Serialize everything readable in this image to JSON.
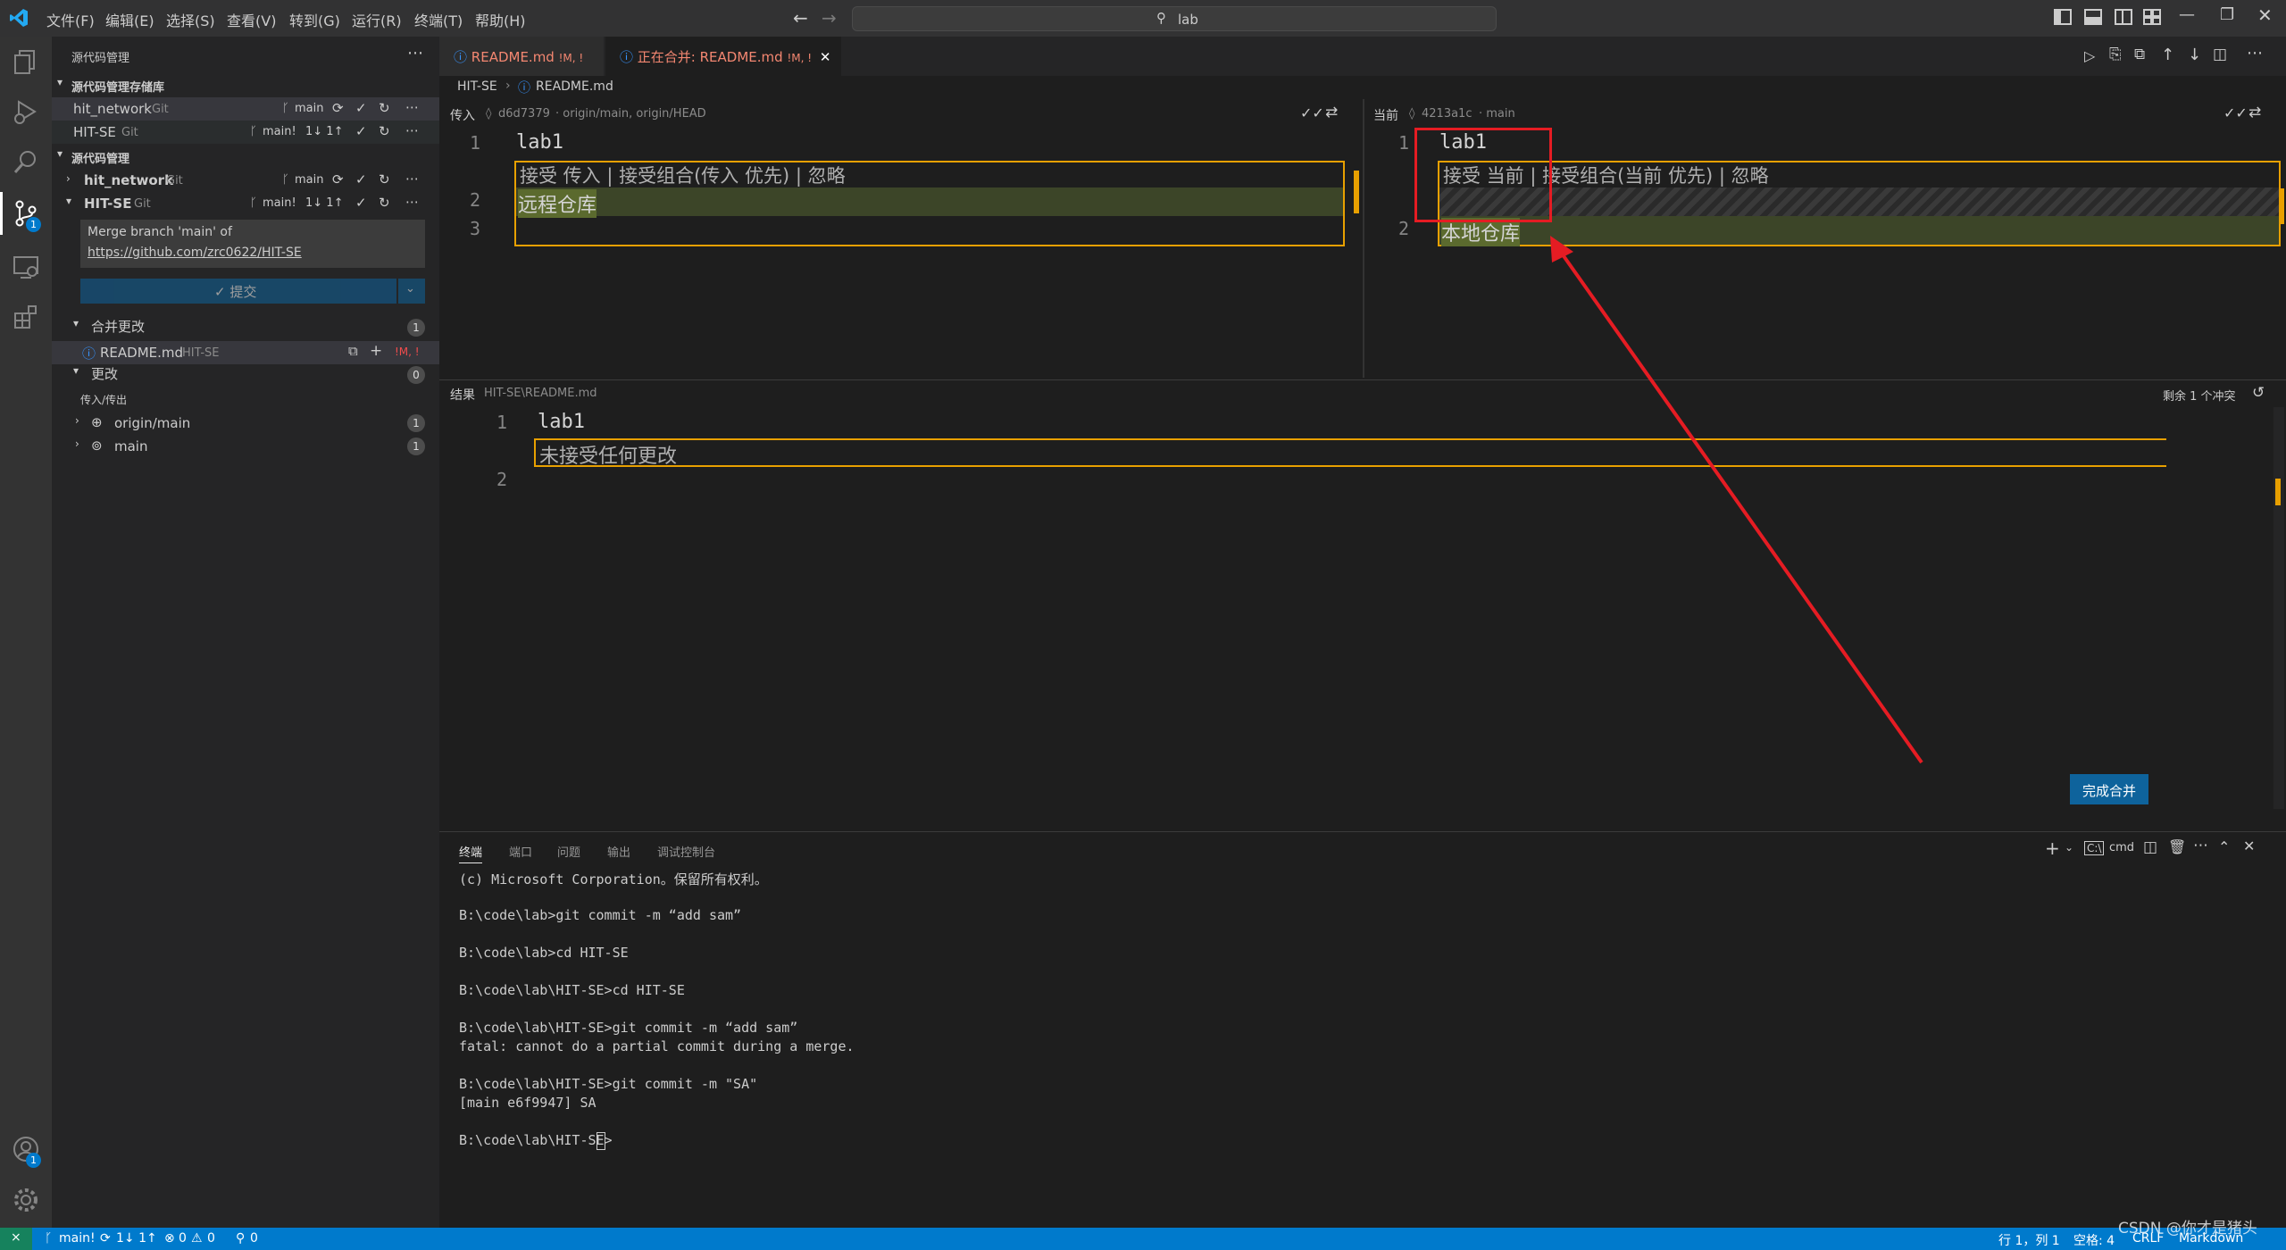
{
  "menu": [
    "文件(F)",
    "编辑(E)",
    "选择(S)",
    "查看(V)",
    "转到(G)",
    "运行(R)",
    "终端(T)",
    "帮助(H)"
  ],
  "search": {
    "text": "lab"
  },
  "sidebar": {
    "title": "源代码管理",
    "repos_section": "源代码管理存储库",
    "repos": [
      {
        "name": "hit_network",
        "type": "Git",
        "branch": "main"
      },
      {
        "name": "HIT-SE",
        "type": "Git",
        "branch": "main!",
        "sync": "1↓ 1↑"
      }
    ],
    "scm_section": "源代码管理",
    "scm_repos": [
      {
        "name": "hit_network",
        "type": "Git",
        "branch": "main"
      },
      {
        "name": "HIT-SE",
        "type": "Git",
        "branch": "main!",
        "sync": "1↓ 1↑"
      }
    ],
    "commit_message_line1": "Merge branch 'main' of",
    "commit_message_line2": "https://github.com/zrc0622/HIT-SE",
    "commit_button": "✓ 提交",
    "merge_changes": {
      "label": "合并更改",
      "count": "1"
    },
    "merge_file": {
      "name": "README.md",
      "repo": "HIT-SE",
      "status": "!M, !"
    },
    "changes": {
      "label": "更改",
      "count": "0"
    },
    "inout_label": "传入/传出",
    "origin_main": {
      "label": "origin/main",
      "count": "1"
    },
    "main": {
      "label": "main",
      "count": "1"
    }
  },
  "tabs": [
    {
      "label": "README.md",
      "status": "!M, !"
    },
    {
      "label": "正在合并: README.md",
      "status": "!M, !"
    }
  ],
  "breadcrumb": {
    "folder": "HIT-SE",
    "file": "README.md"
  },
  "incoming": {
    "label": "传入",
    "hash": "d6d7379",
    "refs": "· origin/main, origin/HEAD",
    "line1": "lab1",
    "actions": "接受 传入 | 接受组合(传入 优先) | 忽略",
    "line2": "远程仓库",
    "nums": [
      "1",
      "2",
      "3"
    ]
  },
  "current": {
    "label": "当前",
    "hash": "4213a1c",
    "refs": "· main",
    "line1": "lab1",
    "actions": "接受 当前 | 接受组合(当前 优先) | 忽略",
    "line2": "本地仓库",
    "nums": [
      "1",
      "2"
    ]
  },
  "result": {
    "label": "结果",
    "path": "HIT-SE\\README.md",
    "conflicts": "剩余 1 个冲突",
    "line1": "lab1",
    "placeholder": "未接受任何更改",
    "nums": [
      "1",
      "2"
    ],
    "complete_button": "完成合并"
  },
  "panel": {
    "tabs": [
      "终端",
      "端口",
      "问题",
      "输出",
      "调试控制台"
    ],
    "shell": "cmd",
    "lines": [
      "(c) Microsoft Corporation。保留所有权利。",
      "",
      "B:\\code\\lab>git commit -m “add sam”",
      "",
      "B:\\code\\lab>cd HIT-SE",
      "",
      "B:\\code\\lab\\HIT-SE>cd HIT-SE",
      "",
      "B:\\code\\lab\\HIT-SE>git commit -m “add sam”",
      "fatal: cannot do a partial commit during a merge.",
      "",
      "B:\\code\\lab\\HIT-SE>git commit -m \"SA\"",
      "[main e6f9947] SA",
      "",
      "B:\\code\\lab\\HIT-SE>"
    ]
  },
  "statusbar": {
    "branch": "main!",
    "sync": "1↓ 1↑",
    "errors": "0",
    "warnings": "0",
    "ports": "0",
    "position": "行 1，列 1",
    "spaces": "空格: 4",
    "eol": "CRLF",
    "language": "Markdown",
    "watermark": "CSDN @你才是猪头"
  },
  "colors": {
    "accent": "#007acc",
    "conflict_border": "#e8a000",
    "annotation": "#e51c23"
  }
}
